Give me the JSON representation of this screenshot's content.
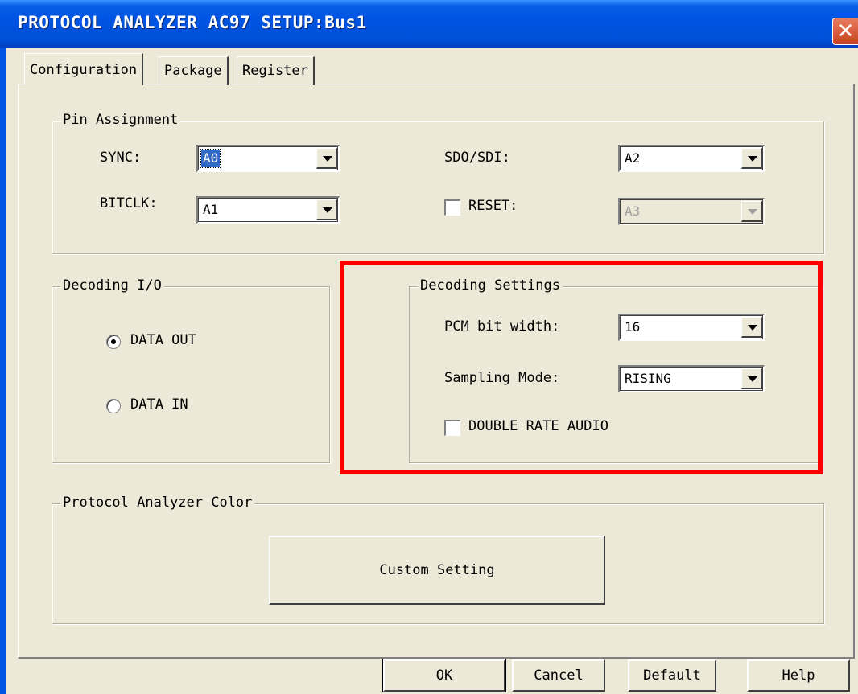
{
  "window": {
    "title": "PROTOCOL ANALYZER AC97 SETUP:Bus1",
    "close_glyph": "✕"
  },
  "tabs": [
    {
      "label": "Configuration",
      "active": true
    },
    {
      "label": "Package",
      "active": false
    },
    {
      "label": "Register",
      "active": false
    }
  ],
  "pin_assignment": {
    "legend": "Pin Assignment",
    "sync": {
      "label": "SYNC:",
      "value": "A0"
    },
    "bitclk": {
      "label": "BITCLK:",
      "value": "A1"
    },
    "sdo_sdi": {
      "label": "SDO/SDI:",
      "value": "A2"
    },
    "reset": {
      "label": "RESET:",
      "value": "A3",
      "checked": false,
      "enabled": false
    }
  },
  "decoding_io": {
    "legend": "Decoding I/O",
    "data_out": {
      "label": "DATA OUT",
      "selected": true
    },
    "data_in": {
      "label": "DATA IN",
      "selected": false
    }
  },
  "decoding_settings": {
    "legend": "Decoding Settings",
    "pcm_bit_width": {
      "label": "PCM bit width:",
      "value": "16"
    },
    "sampling_mode": {
      "label": "Sampling Mode:",
      "value": "RISING"
    },
    "double_rate_audio": {
      "label": "DOUBLE RATE AUDIO",
      "checked": false
    }
  },
  "color_group": {
    "legend": "Protocol Analyzer Color",
    "custom_button": "Custom Setting"
  },
  "buttons": {
    "ok": "OK",
    "cancel": "Cancel",
    "default": "Default",
    "help": "Help"
  },
  "colors": {
    "titlebar": "#0054e3",
    "face": "#ece9d8",
    "highlight": "#ff0000"
  }
}
